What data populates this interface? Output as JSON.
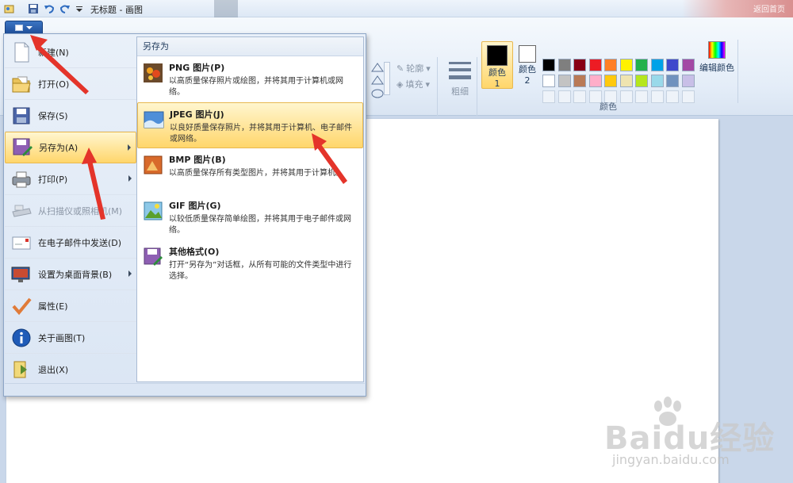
{
  "window": {
    "title": "无标题 - 画图",
    "background_app_text": "返回首页"
  },
  "ribbon": {
    "outline_label": "轮廓",
    "fill_label": "填充",
    "size_label": "粗细",
    "color1_label": "颜色 1",
    "color2_label": "颜色 2",
    "edit_colors_label": "编辑颜色",
    "colors_group_label": "颜色",
    "color1_value": "#000000",
    "color2_value": "#ffffff",
    "palette_row1": [
      "#000000",
      "#7f7f7f",
      "#880015",
      "#ed1c24",
      "#ff7f27",
      "#fff200",
      "#22b14c",
      "#00a2e8",
      "#3f48cc",
      "#a349a4"
    ],
    "palette_row2": [
      "#ffffff",
      "#c3c3c3",
      "#b97a57",
      "#ffaec9",
      "#ffc90e",
      "#efe4b0",
      "#b5e61d",
      "#99d9ea",
      "#7092be",
      "#c8bfe7"
    ]
  },
  "app_menu": {
    "items": [
      {
        "label": "新建(N)",
        "icon": "new-file-icon"
      },
      {
        "label": "打开(O)",
        "icon": "open-folder-icon"
      },
      {
        "label": "保存(S)",
        "icon": "save-disk-icon"
      },
      {
        "label": "另存为(A)",
        "icon": "save-as-icon"
      },
      {
        "label": "打印(P)",
        "icon": "printer-icon"
      },
      {
        "label": "从扫描仪或照相机(M)",
        "icon": "scanner-icon"
      },
      {
        "label": "在电子邮件中发送(D)",
        "icon": "email-icon"
      },
      {
        "label": "设置为桌面背景(B)",
        "icon": "desktop-background-icon"
      },
      {
        "label": "属性(E)",
        "icon": "checkmark-icon"
      },
      {
        "label": "关于画图(T)",
        "icon": "info-icon"
      },
      {
        "label": "退出(X)",
        "icon": "exit-icon"
      }
    ],
    "save_as_panel": {
      "heading": "另存为",
      "options": [
        {
          "title": "PNG 图片(P)",
          "desc": "以高质量保存照片或绘图，并将其用于计算机或网络。"
        },
        {
          "title": "JPEG 图片(J)",
          "desc": "以良好质量保存照片，并将其用于计算机、电子邮件或网络。"
        },
        {
          "title": "BMP 图片(B)",
          "desc": "以高质量保存所有类型图片，并将其用于计算机。"
        },
        {
          "title": "GIF 图片(G)",
          "desc": "以较低质量保存简单绘图，并将其用于电子邮件或网络。"
        },
        {
          "title": "其他格式(O)",
          "desc": "打开“另存为”对话框，从所有可能的文件类型中进行选择。"
        }
      ]
    }
  },
  "watermark": {
    "brand": "Baidu经验",
    "url": "jingyan.baidu.com"
  }
}
